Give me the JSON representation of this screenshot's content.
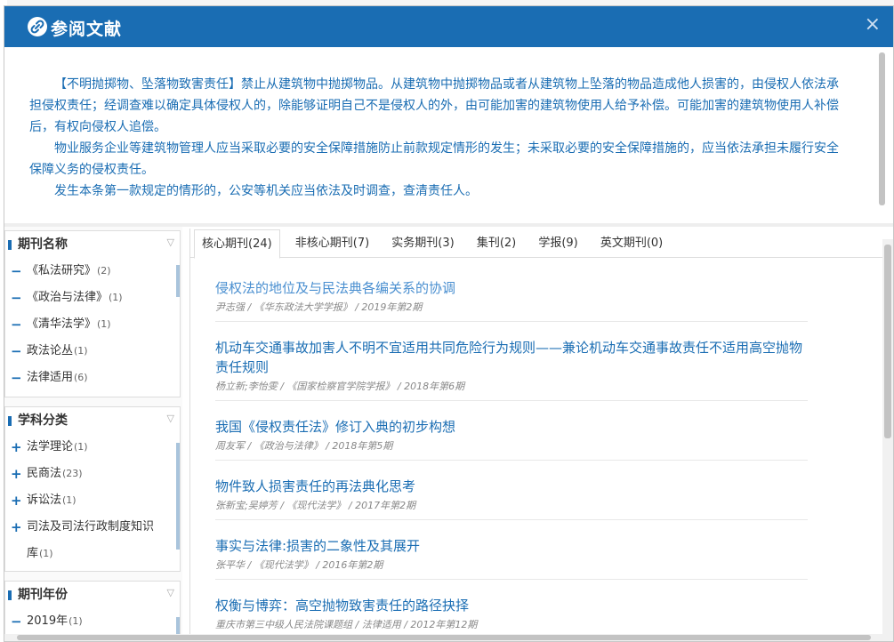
{
  "modal": {
    "title": "参阅文献",
    "close": "×",
    "link_icon": "link-icon",
    "close_icon": "close-icon"
  },
  "law_text": [
    "【不明抛掷物、坠落物致害责任】禁止从建筑物中抛掷物品。从建筑物中抛掷物品或者从建筑物上坠落的物品造成他人损害的，由侵权人依法承担侵权责任；经调查难以确定具体侵权人的，除能够证明自己不是侵权人的外，由可能加害的建筑物使用人给予补偿。可能加害的建筑物使用人补偿后，有权向侵权人追偿。",
    "物业服务企业等建筑物管理人应当采取必要的安全保障措施防止前款规定情形的发生；未采取必要的安全保障措施的，应当依法承担未履行安全保障义务的侵权责任。",
    "发生本条第一款规定的情形的，公安等机关应当依法及时调查，查清责任人。"
  ],
  "sidebar": {
    "journals": {
      "title": "期刊名称",
      "items": [
        {
          "sym": "−",
          "label": "《私法研究》",
          "count": "(2)"
        },
        {
          "sym": "−",
          "label": "《政治与法律》",
          "count": "(1)"
        },
        {
          "sym": "−",
          "label": "《清华法学》",
          "count": "(1)"
        },
        {
          "sym": "−",
          "label": "政法论丛",
          "count": "(1)"
        },
        {
          "sym": "−",
          "label": "法律适用",
          "count": "(6)"
        }
      ]
    },
    "subjects": {
      "title": "学科分类",
      "items": [
        {
          "sym": "+",
          "label": "法学理论",
          "count": "(1)"
        },
        {
          "sym": "+",
          "label": "民商法",
          "count": "(23)"
        },
        {
          "sym": "+",
          "label": "诉讼法",
          "count": "(1)"
        },
        {
          "sym": "+",
          "label": "司法及司法行政制度知识库",
          "count": "(1)"
        }
      ]
    },
    "years": {
      "title": "期刊年份",
      "items": [
        {
          "sym": "−",
          "label": "2019年",
          "count": "(1)"
        }
      ]
    }
  },
  "tabs": [
    {
      "label": "核心期刊(24)",
      "active": true
    },
    {
      "label": "非核心期刊(7)",
      "active": false
    },
    {
      "label": "实务期刊(3)",
      "active": false
    },
    {
      "label": "集刊(2)",
      "active": false
    },
    {
      "label": "学报(9)",
      "active": false
    },
    {
      "label": "英文期刊(0)",
      "active": false
    }
  ],
  "results": [
    {
      "title": "侵权法的地位及与民法典各编关系的协调",
      "meta": "尹志强 / 《华东政法大学学报》 / 2019年第2期"
    },
    {
      "title": "机动车交通事故加害人不明不宜适用共同危险行为规则——兼论机动车交通事故责任不适用高空抛物责任规则",
      "meta": "杨立新;李怡雯 / 《国家检察官学院学报》 / 2018年第6期"
    },
    {
      "title": "我国《侵权责任法》修订入典的初步构想",
      "meta": "周友军 / 《政治与法律》 / 2018年第5期"
    },
    {
      "title": "物件致人损害责任的再法典化思考",
      "meta": "张新宝;吴婷芳 / 《现代法学》 / 2017年第2期"
    },
    {
      "title": "事实与法律:损害的二象性及其展开",
      "meta": "张平华 / 《现代法学》 / 2016年第2期"
    },
    {
      "title": "权衡与博弈：高空抛物致害责任的路径抉择",
      "meta": "重庆市第三中级人民法院课题组 / 法律适用 / 2012年第12期"
    }
  ]
}
